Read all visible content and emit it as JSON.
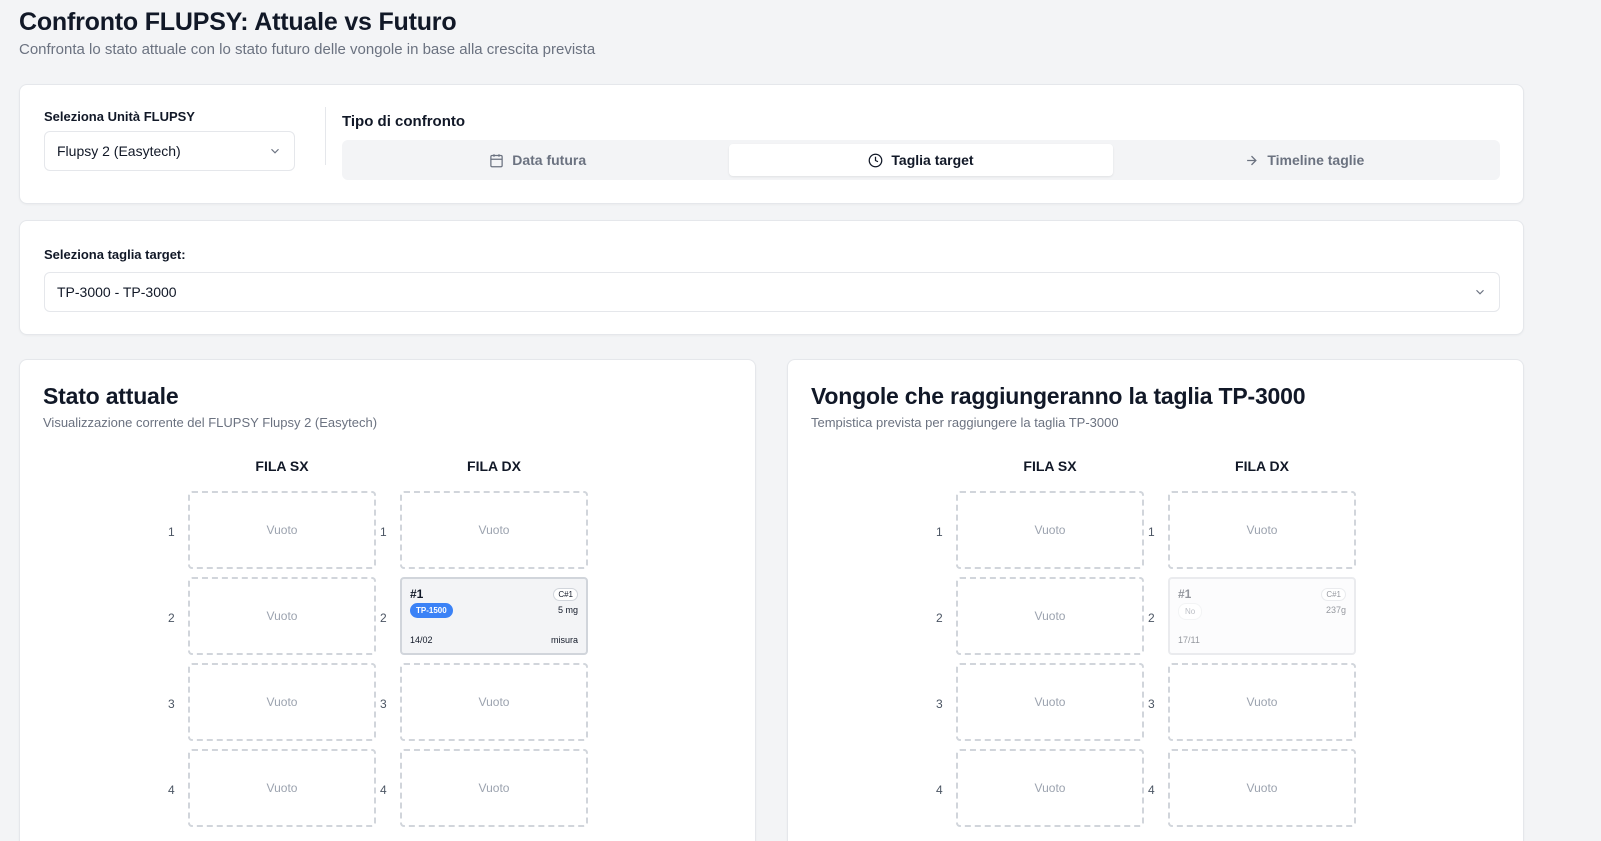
{
  "header": {
    "title": "Confronto FLUPSY: Attuale vs Futuro",
    "subtitle": "Confronta lo stato attuale con lo stato futuro delle vongole in base alla crescita prevista"
  },
  "unit_select": {
    "label": "Seleziona Unità FLUPSY",
    "value": "Flupsy 2 (Easytech)"
  },
  "comparison": {
    "label": "Tipo di confronto",
    "tabs": [
      {
        "label": "Data futura",
        "icon": "calendar-icon",
        "active": false
      },
      {
        "label": "Taglia target",
        "icon": "clock-icon",
        "active": true
      },
      {
        "label": "Timeline taglie",
        "icon": "arrow-right-icon",
        "active": false
      }
    ]
  },
  "target_select": {
    "label": "Seleziona taglia target:",
    "value": "TP-3000 - TP-3000"
  },
  "current_panel": {
    "title": "Stato attuale",
    "subtitle": "Visualizzazione corrente del FLUPSY Flupsy 2 (Easytech)",
    "col_left": "FILA SX",
    "col_right": "FILA DX",
    "row_numbers": [
      "1",
      "2",
      "3",
      "4"
    ],
    "empty_label": "Vuoto",
    "basket": {
      "number": "#1",
      "cycle": "C#1",
      "size": "TP-1500",
      "weight": "5 mg",
      "date": "14/02",
      "operation": "misura"
    }
  },
  "future_panel": {
    "title": "Vongole che raggiungeranno la taglia TP-3000",
    "subtitle": "Tempistica prevista per raggiungere la taglia TP-3000",
    "col_left": "FILA SX",
    "col_right": "FILA DX",
    "row_numbers": [
      "1",
      "2",
      "3",
      "4"
    ],
    "empty_label": "Vuoto",
    "basket": {
      "number": "#1",
      "cycle": "C#1",
      "status": "No",
      "weight": "237g",
      "date": "17/11"
    }
  },
  "colors": {
    "accent": "#3b82f6",
    "background": "#f3f4f6"
  }
}
